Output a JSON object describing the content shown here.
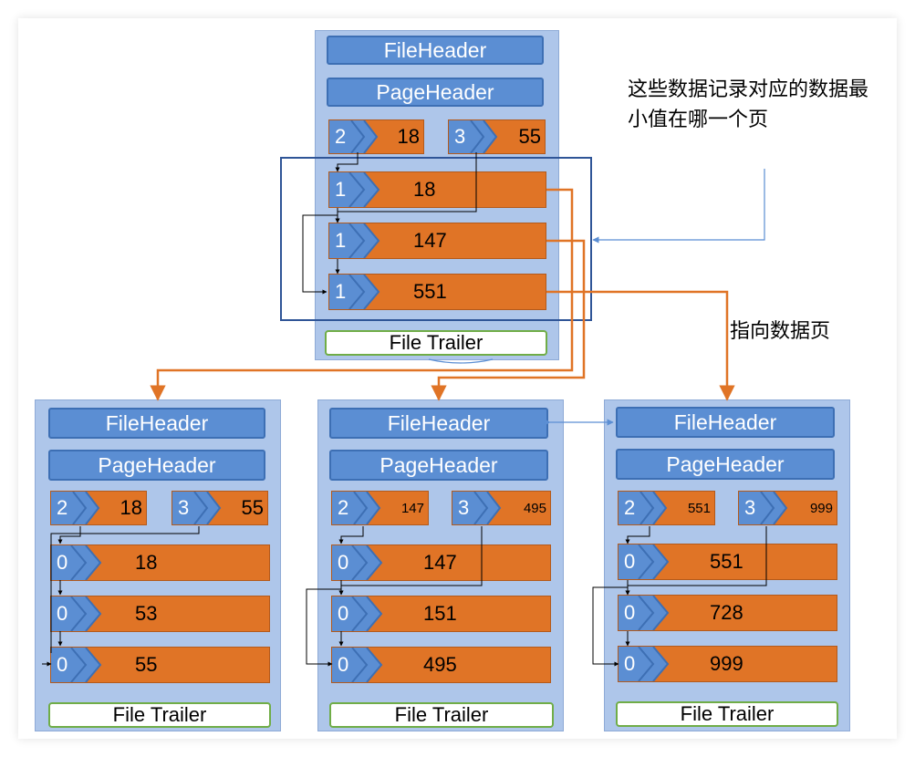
{
  "labels": {
    "file_header": "FileHeader",
    "page_header": "PageHeader",
    "file_trailer": "File Trailer"
  },
  "annotations": {
    "record_min_value_note": "这些数据记录对应的数据最小值在哪一个页",
    "points_to_data_page": "指向数据页"
  },
  "pages": {
    "root": {
      "dir": [
        {
          "slot": "2",
          "value": "18"
        },
        {
          "slot": "3",
          "value": "55"
        }
      ],
      "records": [
        {
          "type": "1",
          "value": "18"
        },
        {
          "type": "1",
          "value": "147"
        },
        {
          "type": "1",
          "value": "551"
        }
      ]
    },
    "leaf_left": {
      "dir": [
        {
          "slot": "2",
          "value": "18"
        },
        {
          "slot": "3",
          "value": "55"
        }
      ],
      "records": [
        {
          "type": "0",
          "value": "18"
        },
        {
          "type": "0",
          "value": "53"
        },
        {
          "type": "0",
          "value": "55"
        }
      ]
    },
    "leaf_mid": {
      "dir": [
        {
          "slot": "2",
          "value": "147"
        },
        {
          "slot": "3",
          "value": "495"
        }
      ],
      "records": [
        {
          "type": "0",
          "value": "147"
        },
        {
          "type": "0",
          "value": "151"
        },
        {
          "type": "0",
          "value": "495"
        }
      ]
    },
    "leaf_right": {
      "dir": [
        {
          "slot": "2",
          "value": "551"
        },
        {
          "slot": "3",
          "value": "999"
        }
      ],
      "records": [
        {
          "type": "0",
          "value": "551"
        },
        {
          "type": "0",
          "value": "728"
        },
        {
          "type": "0",
          "value": "999"
        }
      ]
    }
  },
  "colors": {
    "page_bg": "#aec6ea",
    "header_blue": "#5b8ed3",
    "record_orange": "#e07426",
    "trailer_border": "#70ad47",
    "pointer_orange": "#e07426",
    "note_arrow_blue": "#5b8ed3"
  }
}
